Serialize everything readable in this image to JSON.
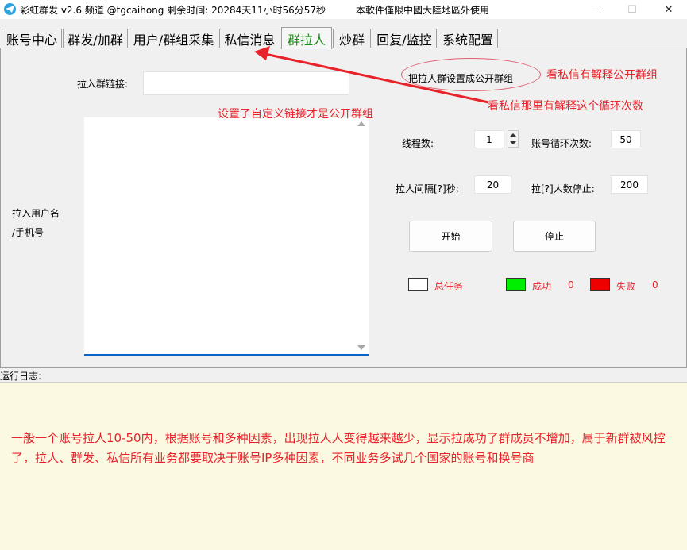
{
  "titlebar": {
    "title": "彩虹群发 v2.6 频道 @tgcaihong  剩余时间: 20284天11小时56分57秒",
    "notice": "本軟件僅限中國大陸地區外使用",
    "minimize": "—",
    "maximize": "☐",
    "close": "✕"
  },
  "tabs": [
    {
      "label": "账号中心"
    },
    {
      "label": "群发/加群"
    },
    {
      "label": "用户/群组采集"
    },
    {
      "label": "私信消息"
    },
    {
      "label": "群拉人"
    },
    {
      "label": "炒群"
    },
    {
      "label": "回复/监控"
    },
    {
      "label": "系统配置"
    }
  ],
  "form": {
    "group_link_label": "拉入群链接:",
    "group_link_value": "",
    "users_label_line1": "拉入用户名",
    "users_label_line2": "/手机号",
    "threads_label": "线程数:",
    "threads_value": "1",
    "account_loops_label": "账号循环次数:",
    "account_loops_value": "50",
    "interval_label": "拉人间隔[?]秒:",
    "interval_value": "20",
    "stop_label": "拉[?]人数停止:",
    "stop_value": "200",
    "start_button": "开始",
    "stop_button": "停止"
  },
  "stats": {
    "total_label": "总任务",
    "success_label": "成功",
    "success_value": "0",
    "fail_label": "失败",
    "fail_value": "0",
    "colors": {
      "total": "#ffffff",
      "success": "#00ee00",
      "fail": "#ee0000"
    }
  },
  "annotations": {
    "public_group_hint": "把拉人群设置成公开群组",
    "dm_explain_public": "看私信有解释公开群组",
    "dm_explain_loops": "看私信那里有解释这个循环次数",
    "custom_link_hint": "设置了自定义链接才是公开群组"
  },
  "log": {
    "label": "运行日志:",
    "text": "一般一个账号拉人10-50内，根据账号和多种因素，出现拉人人变得越来越少，显示拉成功了群成员不增加，属于新群被风控了，拉人、群发、私信所有业务都要取决于账号IP多种因素，不同业务多试几个国家的账号和换号商"
  },
  "colors": {
    "accent_red": "#e8222a",
    "active_tab": "#1a8a1a",
    "log_background": "#fcf9e2"
  }
}
